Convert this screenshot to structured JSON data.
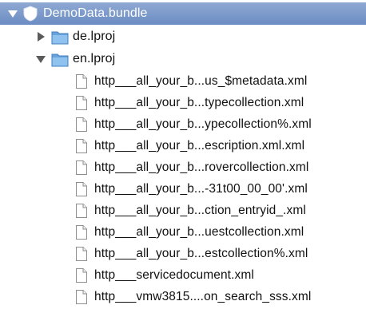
{
  "tree": {
    "root": {
      "label": "DemoData.bundle",
      "icon": "bundle-icon",
      "expanded": true,
      "selected": true
    },
    "folders": [
      {
        "label": "de.lproj",
        "icon": "folder-icon",
        "expanded": false
      },
      {
        "label": "en.lproj",
        "icon": "folder-icon",
        "expanded": true
      }
    ],
    "files": [
      "http___all_your_b...us_$metadata.xml",
      "http___all_your_b...typecollection.xml",
      "http___all_your_b...ypecollection%.xml",
      "http___all_your_b...escription.xml.xml",
      "http___all_your_b...rovercollection.xml",
      "http___all_your_b...-31t00_00_00'.xml",
      "http___all_your_b...ction_entryid_.xml",
      "http___all_your_b...uestcollection.xml",
      "http___all_your_b...estcollection%.xml",
      "http___servicedocument.xml",
      "http___vmw3815....on_search_sss.xml"
    ]
  },
  "colors": {
    "selection_top": "#8fa9d2",
    "selection_bottom": "#6b8cc3",
    "folder_blue": "#7fb3e6"
  }
}
